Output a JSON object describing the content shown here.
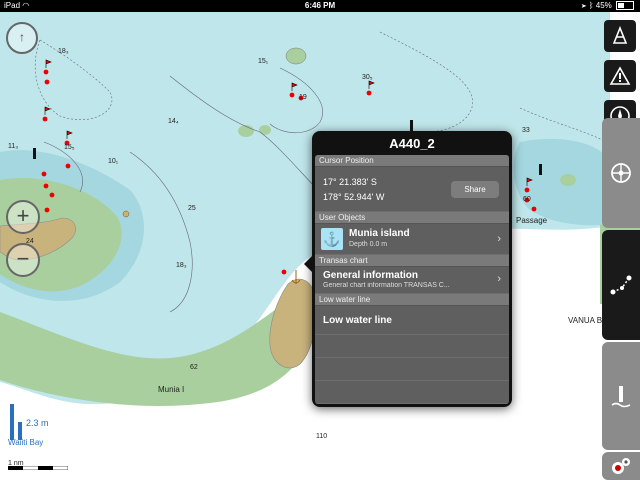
{
  "status_bar": {
    "device": "iPad",
    "time": "6:46 PM",
    "battery": "45%",
    "battery_level": 0.45
  },
  "popover": {
    "title": "A440_2",
    "sections": {
      "cursor": "Cursor Position",
      "user_objects": "User Objects",
      "chart": "Transas chart",
      "low_water": "Low water line"
    },
    "cursor": {
      "lat": "17° 21.383' S",
      "lon": "178° 52.944' W",
      "share_label": "Share"
    },
    "user_object": {
      "name": "Munia island",
      "detail": "Depth 0.0 m"
    },
    "chart_info": {
      "title": "General information",
      "detail": "General chart information TRANSAS C..."
    },
    "low_water_row": "Low water line"
  },
  "map": {
    "soundings": [
      "18₃",
      "15₁",
      "30₅",
      "19",
      "14₄",
      "11₃",
      "15₅",
      "10₁",
      "25",
      "18₃",
      "24",
      "62",
      "110",
      "33",
      "60"
    ],
    "place_labels": {
      "munia": "Munia I",
      "passage": "Passage",
      "vanua": "VANUA B",
      "waiti_bay": "Waiiti Bay"
    },
    "depth_marker": "2.3 m",
    "scale_label": "1 nm",
    "colors": {
      "sea": "#bfe6ea",
      "shallow": "#a4d7e0",
      "deep": "#ffffff",
      "land": "#c9b37c",
      "intertidal": "#a9cf9f"
    }
  },
  "sidebar": {
    "icons": [
      "nautical-ship-icon",
      "warning-icon",
      "compass-icon",
      "helm-icon",
      "route-icon",
      "tide-icon",
      "settings-icon"
    ]
  }
}
